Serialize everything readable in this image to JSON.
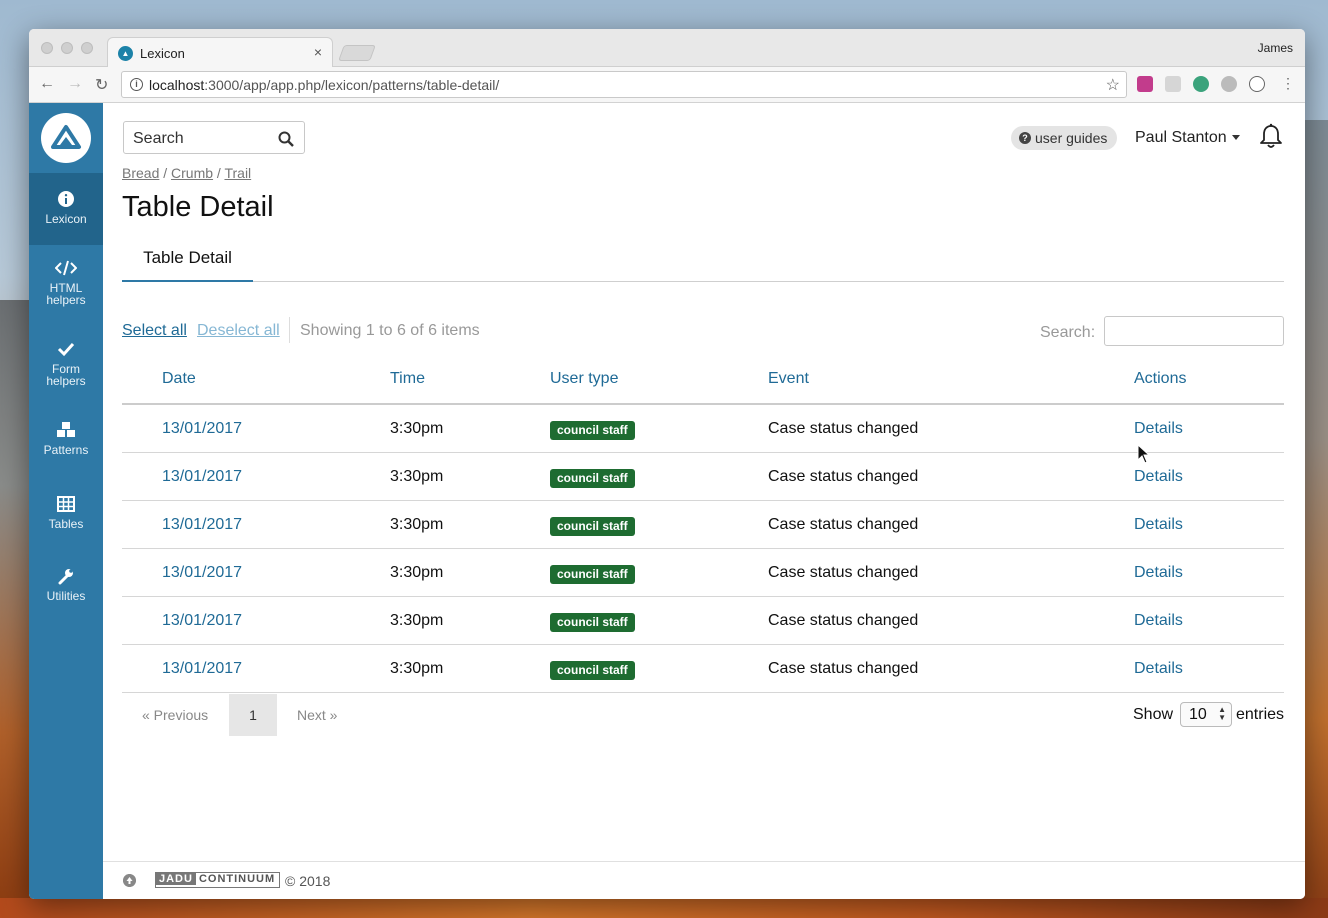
{
  "browser": {
    "tab_title": "Lexicon",
    "tab_favicon_name": "jadu-logo-icon",
    "profile_name": "James",
    "url_host": "localhost",
    "url_rest": ":3000/app/app.php/lexicon/patterns/table-detail/"
  },
  "sidebar": {
    "items": [
      {
        "label": "Lexicon",
        "icon": "info-icon",
        "active": true
      },
      {
        "label": "HTML\nhelpers",
        "icon": "code-icon"
      },
      {
        "label": "Form\nhelpers",
        "icon": "check-icon"
      },
      {
        "label": "Patterns",
        "icon": "cubes-icon"
      },
      {
        "label": "Tables",
        "icon": "table-icon"
      },
      {
        "label": "Utilities",
        "icon": "wrench-icon"
      }
    ]
  },
  "header": {
    "search_placeholder": "Search",
    "guides_label": "user guides",
    "user_name": "Paul Stanton"
  },
  "breadcrumb": [
    "Bread",
    "Crumb",
    "Trail"
  ],
  "page_title": "Table Detail",
  "tabs": [
    {
      "label": "Table Detail",
      "active": true
    }
  ],
  "table_controls": {
    "select_all": "Select all",
    "deselect_all": "Deselect all",
    "showing": "Showing 1 to 6 of 6 items",
    "search_label": "Search:"
  },
  "table": {
    "columns": [
      "Date",
      "Time",
      "User type",
      "Event",
      "Actions"
    ],
    "rows": [
      {
        "date": "13/01/2017",
        "time": "3:30pm",
        "user_type": "council staff",
        "event": "Case status changed",
        "action": "Details"
      },
      {
        "date": "13/01/2017",
        "time": "3:30pm",
        "user_type": "council staff",
        "event": "Case status changed",
        "action": "Details"
      },
      {
        "date": "13/01/2017",
        "time": "3:30pm",
        "user_type": "council staff",
        "event": "Case status changed",
        "action": "Details"
      },
      {
        "date": "13/01/2017",
        "time": "3:30pm",
        "user_type": "council staff",
        "event": "Case status changed",
        "action": "Details"
      },
      {
        "date": "13/01/2017",
        "time": "3:30pm",
        "user_type": "council staff",
        "event": "Case status changed",
        "action": "Details"
      },
      {
        "date": "13/01/2017",
        "time": "3:30pm",
        "user_type": "council staff",
        "event": "Case status changed",
        "action": "Details"
      }
    ]
  },
  "pagination": {
    "previous": "« Previous",
    "current": "1",
    "next": "Next »",
    "show_label": "Show",
    "page_size": "10",
    "entries_label": "entries"
  },
  "footer": {
    "logo_jadu": "JADU",
    "logo_continuum": "CONTINUUM",
    "copyright": "© 2018"
  },
  "colors": {
    "sidebar": "#2e79a6",
    "sidebar_active": "#22648b",
    "link": "#1f6a96",
    "badge": "#1e6c31"
  }
}
